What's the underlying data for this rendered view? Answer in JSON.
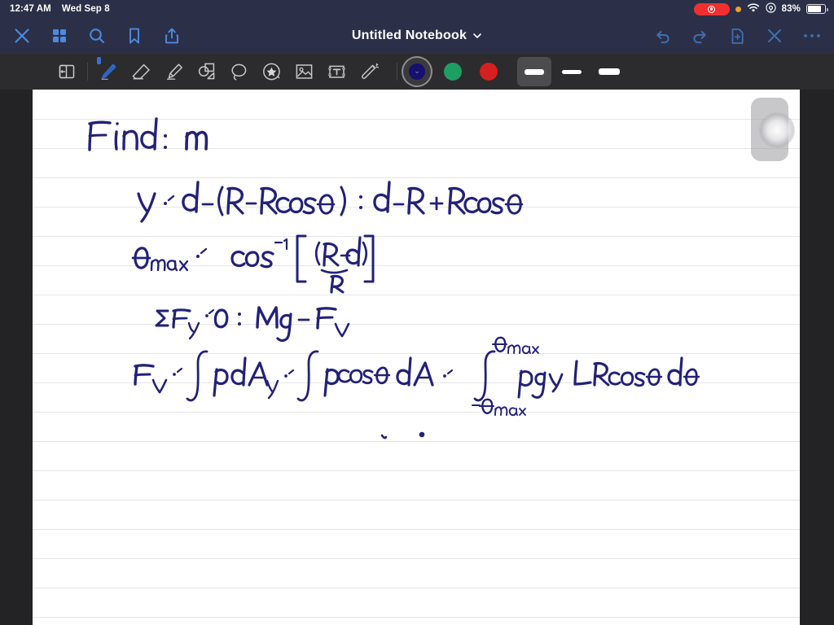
{
  "statusbar": {
    "time": "12:47 AM",
    "date": "Wed Sep 8",
    "battery_percent": "83%",
    "icons": {
      "recording": "record-indicator",
      "privacy_dot": "orange-privacy-dot",
      "wifi": "wifi-icon",
      "location": "location-services-icon",
      "battery": "battery-icon"
    }
  },
  "navbar": {
    "title": "Untitled Notebook",
    "title_chevron": "chevron-down-icon",
    "left_buttons": [
      {
        "name": "close-icon",
        "label": "Close"
      },
      {
        "name": "thumbnails-grid-icon",
        "label": "Thumbnails"
      },
      {
        "name": "search-icon",
        "label": "Search"
      },
      {
        "name": "bookmark-icon",
        "label": "Bookmark"
      },
      {
        "name": "share-icon",
        "label": "Share"
      }
    ],
    "right_buttons": [
      {
        "name": "undo-icon",
        "label": "Undo"
      },
      {
        "name": "redo-icon",
        "label": "Redo"
      },
      {
        "name": "new-page-icon",
        "label": "New Page"
      },
      {
        "name": "close-toolbar-icon",
        "label": "Close"
      },
      {
        "name": "more-options-icon",
        "label": "More"
      }
    ]
  },
  "toolbar": {
    "tools": [
      {
        "name": "page-layout-tool",
        "label": "Page Layout",
        "active": false
      },
      {
        "name": "pen-tool",
        "label": "Pen",
        "active": true
      },
      {
        "name": "eraser-tool",
        "label": "Eraser",
        "active": false
      },
      {
        "name": "highlighter-tool",
        "label": "Highlighter",
        "active": false
      },
      {
        "name": "shapes-tool",
        "label": "Shapes",
        "active": false
      },
      {
        "name": "lasso-tool",
        "label": "Lasso",
        "active": false
      },
      {
        "name": "sticker-tool",
        "label": "Sticker",
        "active": false
      },
      {
        "name": "image-tool",
        "label": "Image",
        "active": false
      },
      {
        "name": "text-box-tool",
        "label": "Text Box",
        "active": false
      },
      {
        "name": "magic-wand-tool",
        "label": "Magic Wand",
        "active": false
      }
    ],
    "colors": [
      {
        "name": "color-navy",
        "hex": "#16106e",
        "selected": true
      },
      {
        "name": "color-green",
        "hex": "#1f9e63",
        "selected": false
      },
      {
        "name": "color-red",
        "hex": "#d61f1f",
        "selected": false
      }
    ],
    "stroke_widths": [
      {
        "name": "stroke-width-thick",
        "thickness": 7,
        "length": 24,
        "selected": true
      },
      {
        "name": "stroke-width-medium",
        "thickness": 5,
        "length": 24,
        "selected": false
      },
      {
        "name": "stroke-width-thin",
        "thickness": 8,
        "length": 26,
        "selected": false
      }
    ]
  },
  "notes": {
    "ink_color": "#232178",
    "lines": [
      {
        "id": "find-m",
        "text": "Find:  m"
      },
      {
        "id": "y-equation",
        "text": "y = d - (R - Rcosθ)  =  d - R + Rcosθ"
      },
      {
        "id": "theta-max",
        "text": "θmax =  cos"
      },
      {
        "id": "sum-forces",
        "text": "ΣFy = 0  =  Mg - Fv"
      },
      {
        "id": "fv-integral",
        "text": "Fv ="
      }
    ],
    "theta_max": {
      "label": "θmax",
      "equals": "=",
      "fn": "cos",
      "exponent": "-1",
      "numerator": "(R-d)",
      "denominator": "R"
    },
    "fv_integral": {
      "lhs": "Fv",
      "eq1": "=",
      "term1": "∫ p dAy",
      "eq2": "=",
      "term2": "∫ pcosθ dA",
      "eq3": "=",
      "upper_limit": "θmax",
      "lower_limit": "-θmax",
      "integrand": "ρgy LRcosθ dθ"
    },
    "stray_marks": 2
  },
  "canvas": {
    "page_background": "#ffffff",
    "rule_color": "#e6e6e8",
    "rule_spacing": 36,
    "scroll_handle": "page-scroll-handle",
    "touch_indicator": "touch-indicator"
  }
}
